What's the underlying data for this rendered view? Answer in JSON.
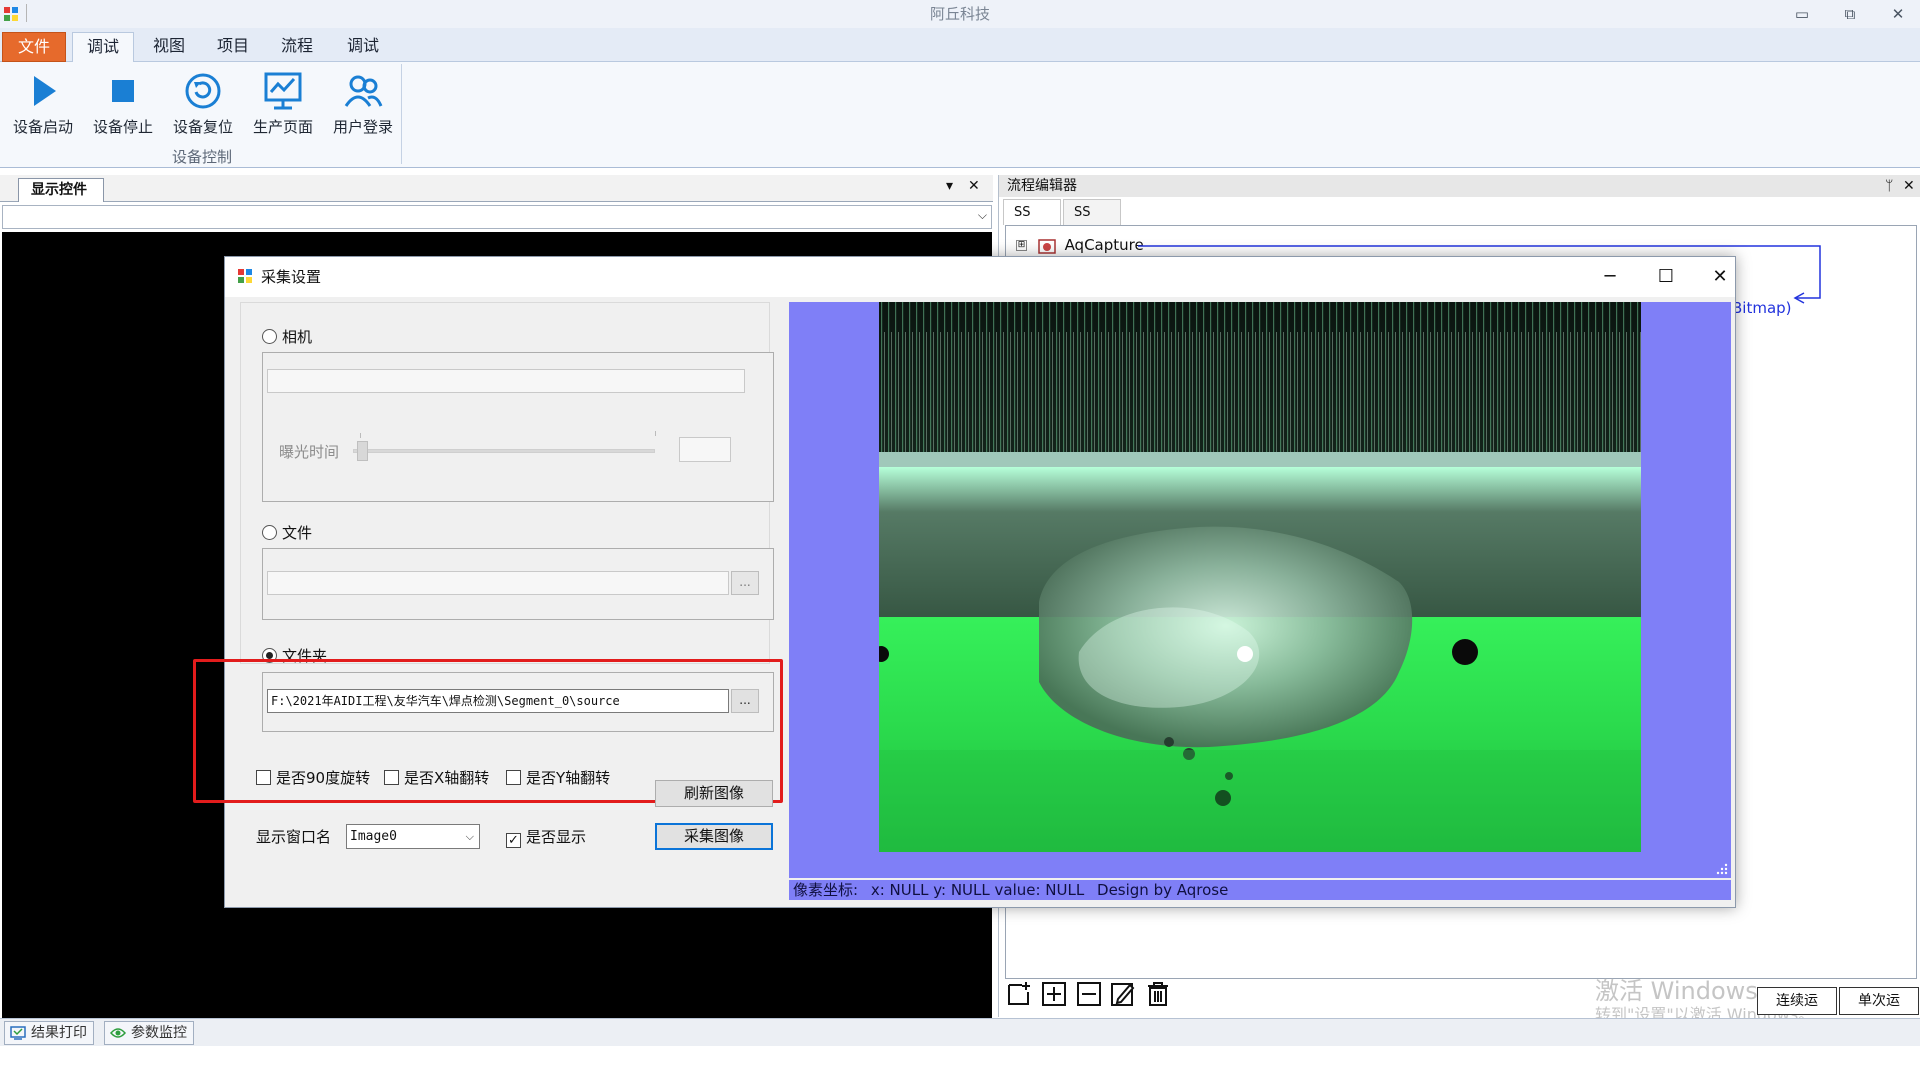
{
  "window": {
    "title": "阿丘科技",
    "minimize_icon": "minimize-icon",
    "restore_icon": "restore-icon",
    "close_icon": "close-icon"
  },
  "menu": {
    "tabs": [
      "文件",
      "调试",
      "视图",
      "项目",
      "流程",
      "调试"
    ],
    "active_index": 1,
    "file_color": "#e66a2c"
  },
  "ribbon": {
    "buttons": [
      {
        "label": "设备启动",
        "icon": "play-icon"
      },
      {
        "label": "设备停止",
        "icon": "stop-icon"
      },
      {
        "label": "设备复位",
        "icon": "reset-icon"
      },
      {
        "label": "生产页面",
        "icon": "monitor-chart-icon"
      },
      {
        "label": "用户登录",
        "icon": "users-icon"
      }
    ],
    "group_label": "设备控制",
    "accent": "#1a7fd4"
  },
  "left_panel": {
    "tab_label": "显示控件",
    "pin": "▾",
    "close": "✕"
  },
  "right_panel": {
    "title": "流程编辑器",
    "pin": "ᛘ",
    "close": "✕",
    "tabs": [
      "SS",
      "SS"
    ],
    "tree_node": "AqCapture",
    "tree_expander": "⊞",
    "connector_text": "Bitmap)",
    "toolbar_icons": [
      "new-icon",
      "add-icon",
      "remove-icon",
      "edit-icon",
      "delete-icon"
    ],
    "run_continuous": "连续运",
    "run_once": "单次运",
    "watermark_line1": "激活 Windows",
    "watermark_line2": "转到\"设置\"以激活 Windows。"
  },
  "status_tabs": [
    {
      "label": "结果打印",
      "icon": "print-result-icon"
    },
    {
      "label": "参数监控",
      "icon": "eye-icon"
    }
  ],
  "dialog": {
    "title": "采集设置",
    "min": "─",
    "max": "☐",
    "close": "✕",
    "source_options": [
      {
        "label": "相机",
        "selected": false
      },
      {
        "label": "文件",
        "selected": false
      },
      {
        "label": "文件夹",
        "selected": true
      }
    ],
    "camera_field": "",
    "exposure_label": "曝光时间",
    "exposure_value": "",
    "file_path": "",
    "folder_path": "F:\\2021年AIDI工程\\友华汽车\\焊点检测\\Segment_0\\source",
    "browse_label": "...",
    "checkboxes": [
      {
        "label": "是否90度旋转",
        "checked": false
      },
      {
        "label": "是否X轴翻转",
        "checked": false
      },
      {
        "label": "是否Y轴翻转",
        "checked": false
      }
    ],
    "refresh_button": "刷新图像",
    "window_name_label": "显示窗口名",
    "window_name_value": "Image0",
    "show_checkbox": {
      "label": "是否显示",
      "checked": true
    },
    "capture_button": "采集图像",
    "viewer_bg": "#7f7ff7",
    "status": {
      "pixel_label": "像素坐标:",
      "coords": "x: NULL y: NULL value: NULL",
      "design": "Design by Aqrose"
    }
  }
}
